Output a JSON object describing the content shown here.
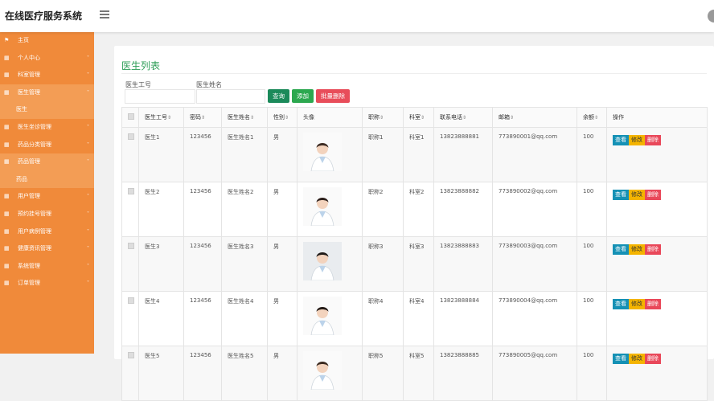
{
  "header": {
    "app_title": "在线医疗服务系统"
  },
  "sidebar": {
    "items": [
      {
        "label": "主页",
        "icon": "flag-icon",
        "has_children": false,
        "active": false
      },
      {
        "label": "个人中心",
        "icon": "grid-icon",
        "has_children": true,
        "active": false
      },
      {
        "label": "科室管理",
        "icon": "grid-icon",
        "has_children": true,
        "active": false
      },
      {
        "label": "医生管理",
        "icon": "grid-icon",
        "has_children": true,
        "active": true,
        "sub": "医生"
      },
      {
        "label": "医生坐诊管理",
        "icon": "grid-icon",
        "has_children": true,
        "active": false
      },
      {
        "label": "药品分类管理",
        "icon": "grid-icon",
        "has_children": true,
        "active": false
      },
      {
        "label": "药品管理",
        "icon": "grid-icon",
        "has_children": true,
        "active": true,
        "sub": "药品"
      },
      {
        "label": "用户管理",
        "icon": "grid-icon",
        "has_children": true,
        "active": false
      },
      {
        "label": "预约挂号管理",
        "icon": "grid-icon",
        "has_children": true,
        "active": false
      },
      {
        "label": "用户病例管理",
        "icon": "grid-icon",
        "has_children": true,
        "active": false
      },
      {
        "label": "健康资讯管理",
        "icon": "grid-icon",
        "has_children": true,
        "active": false
      },
      {
        "label": "系统管理",
        "icon": "grid-icon",
        "has_children": true,
        "active": false
      },
      {
        "label": "订单管理",
        "icon": "grid-icon",
        "has_children": true,
        "active": false
      }
    ]
  },
  "main": {
    "title": "医生列表",
    "filters": {
      "doctor_no_label": "医生工号",
      "doctor_no_value": "",
      "doctor_name_label": "医生姓名",
      "doctor_name_value": ""
    },
    "buttons": {
      "search": "查询",
      "add": "添加",
      "bulk_delete": "批量删除"
    },
    "columns": [
      "医生工号",
      "密码",
      "医生姓名",
      "性别",
      "头像",
      "职称",
      "科室",
      "联系电话",
      "邮箱",
      "余额",
      "操作"
    ],
    "sortable": [
      true,
      true,
      true,
      true,
      false,
      true,
      true,
      true,
      true,
      true,
      false
    ],
    "row_actions": {
      "view": "查看",
      "edit": "修改",
      "delete": "删除"
    },
    "rows": [
      {
        "doctor_no": "医生1",
        "password": "123456",
        "name": "医生姓名1",
        "gender": "男",
        "title": "职称1",
        "dept": "科室1",
        "phone": "13823888881",
        "email": "773890001@qq.com",
        "balance": "100"
      },
      {
        "doctor_no": "医生2",
        "password": "123456",
        "name": "医生姓名2",
        "gender": "男",
        "title": "职称2",
        "dept": "科室2",
        "phone": "13823888882",
        "email": "773890002@qq.com",
        "balance": "100"
      },
      {
        "doctor_no": "医生3",
        "password": "123456",
        "name": "医生姓名3",
        "gender": "男",
        "title": "职称3",
        "dept": "科室3",
        "phone": "13823888883",
        "email": "773890003@qq.com",
        "balance": "100"
      },
      {
        "doctor_no": "医生4",
        "password": "123456",
        "name": "医生姓名4",
        "gender": "男",
        "title": "职称4",
        "dept": "科室4",
        "phone": "13823888884",
        "email": "773890004@qq.com",
        "balance": "100"
      },
      {
        "doctor_no": "医生5",
        "password": "123456",
        "name": "医生姓名5",
        "gender": "男",
        "title": "职称5",
        "dept": "科室5",
        "phone": "13823888885",
        "email": "773890005@qq.com",
        "balance": "100"
      }
    ]
  },
  "colors": {
    "sidebar": "#f08a3a",
    "accent_green": "#2c9d56",
    "view": "#1591b5",
    "edit": "#f4b400",
    "delete": "#e9485a"
  }
}
